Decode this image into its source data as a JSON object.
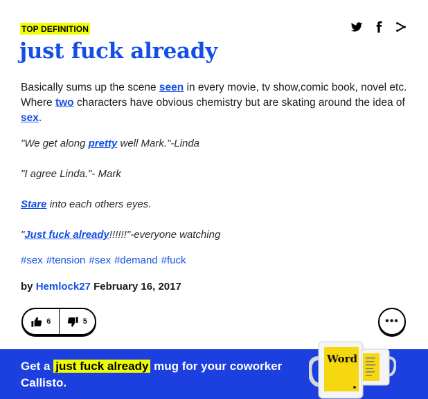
{
  "entry": {
    "badge": "TOP DEFINITION",
    "word": "just fuck already",
    "meaning": {
      "part1": "Basically sums up the scene ",
      "link1": "seen",
      "part2": " in every movie, tv show,comic book, novel etc. Where ",
      "link2": "two",
      "part3": " characters have obvious chemistry but are skating around the idea of ",
      "link3": "sex",
      "part4": "."
    },
    "examples": {
      "ex1_a": "\"We get along ",
      "ex1_link": "pretty",
      "ex1_b": " well Mark.\"-Linda",
      "ex2": "\"I agree Linda.\"- Mark",
      "ex3_link": "Stare",
      "ex3_b": " into each others eyes.",
      "ex4_a": "\"",
      "ex4_link": "Just fuck already",
      "ex4_b": "!!!!!!\"-everyone watching"
    },
    "tags": [
      "#sex",
      "#tension",
      "#sex",
      "#demand",
      "#fuck"
    ],
    "author": {
      "by": "by ",
      "name": "Hemlock27",
      "date": " February 16, 2017"
    },
    "votes": {
      "up": "6",
      "down": "5"
    },
    "more_label": "•••"
  },
  "share": {
    "icons": [
      "twitter-icon",
      "facebook-icon",
      "share-icon"
    ]
  },
  "promo": {
    "prefix": "Get a ",
    "highlight": "just fuck already",
    "suffix": " mug for your coworker Callisto.",
    "mug_word": "Word"
  },
  "colors": {
    "accent": "#134fe6",
    "highlight": "#efff00",
    "promo_bg": "#1c3fe0"
  }
}
